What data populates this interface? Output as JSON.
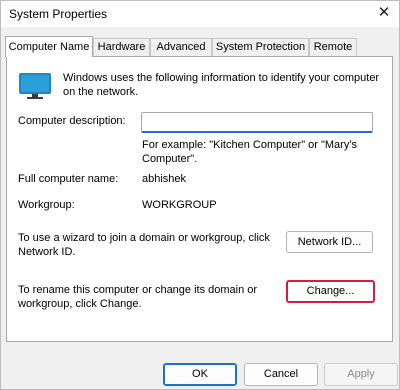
{
  "window": {
    "title": "System Properties",
    "close_glyph": "✕"
  },
  "tabs": [
    {
      "label": "Computer Name",
      "active": true
    },
    {
      "label": "Hardware"
    },
    {
      "label": "Advanced"
    },
    {
      "label": "System Protection"
    },
    {
      "label": "Remote"
    }
  ],
  "panel": {
    "intro": "Windows uses the following information to identify your computer on the network.",
    "description_label": "Computer description:",
    "description_value": "",
    "example_text": "For example: \"Kitchen Computer\" or \"Mary's Computer\".",
    "full_name_label": "Full computer name:",
    "full_name_value": "abhishek",
    "workgroup_label": "Workgroup:",
    "workgroup_value": "WORKGROUP",
    "network_text": "To use a wizard to join a domain or workgroup, click Network ID.",
    "network_button": "Network ID...",
    "rename_text": "To rename this computer or change its domain or workgroup, click Change.",
    "change_button": "Change..."
  },
  "footer": {
    "ok": "OK",
    "cancel": "Cancel",
    "apply": "Apply"
  },
  "colors": {
    "accent": "#1a73c8",
    "focus": "#d51c3c",
    "monitor": "#2aa0d8"
  },
  "icons": {
    "computer": "monitor-icon",
    "close": "close-icon"
  }
}
